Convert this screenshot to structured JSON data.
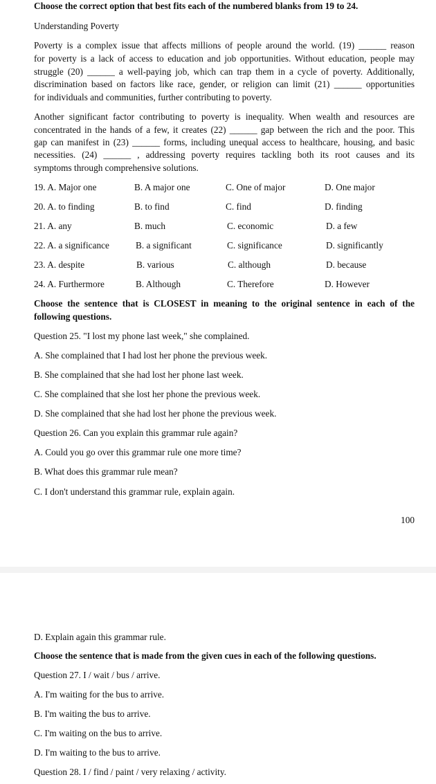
{
  "page1": {
    "section1_heading": "Choose the correct option that best fits each of the numbered blanks from 19 to 24.",
    "passage_title": "Understanding Poverty",
    "paragraph1_lines": [
      "Poverty is a complex issue that affects millions of people around the world. (19) ______ reason",
      "for poverty is a lack of access to education and job opportunities. Without education, people may",
      "struggle (20) ______ a well-paying job, which can trap them in a cycle of poverty. Additionally,",
      "discrimination based on factors like race, gender, or religion can limit (21) ______ opportunities",
      "for individuals and communities, further contributing to poverty."
    ],
    "paragraph2_lines": [
      "Another significant factor contributing to poverty is inequality. When wealth and resources are",
      "concentrated in the hands of a few, it creates (22) ______ gap between the rich and the poor. This",
      "gap can manifest in (23) ______ forms, including unequal access to healthcare, housing, and basic",
      "necessities. (24) ______ , addressing poverty requires tackling both its root causes and its",
      "symptoms through comprehensive solutions."
    ],
    "cloze_questions": [
      {
        "number": "19",
        "options": [
          "19. A. Major one",
          "B. A major one",
          "C. One of major",
          "D. One major"
        ]
      },
      {
        "number": "20",
        "options": [
          "20. A. to finding",
          "B. to find",
          "C. find",
          "D. finding"
        ]
      },
      {
        "number": "21",
        "options": [
          "21. A. any",
          "B. much",
          "C. economic",
          "D. a few"
        ]
      },
      {
        "number": "22",
        "options": [
          "22. A. a significance",
          "B. a significant",
          "C. significance",
          "D. significantly"
        ]
      },
      {
        "number": "23",
        "options": [
          "23. A. despite",
          "B. various",
          "C. although",
          "D. because"
        ]
      },
      {
        "number": "24",
        "options": [
          "24. A. Furthermore",
          "B. Although",
          "C. Therefore",
          "D. However"
        ]
      }
    ],
    "section2_heading_lines": [
      "Choose the sentence that is CLOSEST in meaning to the original sentence in each of the",
      "following questions."
    ],
    "question25": {
      "prompt": "Question 25. \"I lost my phone last week,\" she complained.",
      "options": [
        "A. She complained that I had lost her phone the previous week.",
        "B. She complained that she had lost her phone last week.",
        "C. She complained that she lost her phone the previous week.",
        "D. She complained that she had lost her phone the previous week."
      ]
    },
    "question26": {
      "prompt": "Question 26. Can you explain this grammar rule again?",
      "options": [
        "A. Could you go over this grammar rule one more time?",
        "B. What does this grammar rule mean?",
        "C. I don't understand this grammar rule, explain again."
      ]
    },
    "page_number": "100"
  },
  "page2": {
    "question26_continued": "D. Explain again this grammar rule.",
    "section3_heading": "Choose the sentence that is made from the given cues in each of the following questions.",
    "question27": {
      "prompt": "Question 27. I / wait / bus / arrive.",
      "options": [
        "A. I'm waiting for the bus to arrive.",
        "B. I'm waiting the bus to arrive.",
        "C. I'm waiting on the bus to arrive.",
        "D. I'm waiting to the bus to arrive."
      ]
    },
    "question28": {
      "prompt": "Question 28. I / find / paint / very relaxing / activity."
    }
  }
}
